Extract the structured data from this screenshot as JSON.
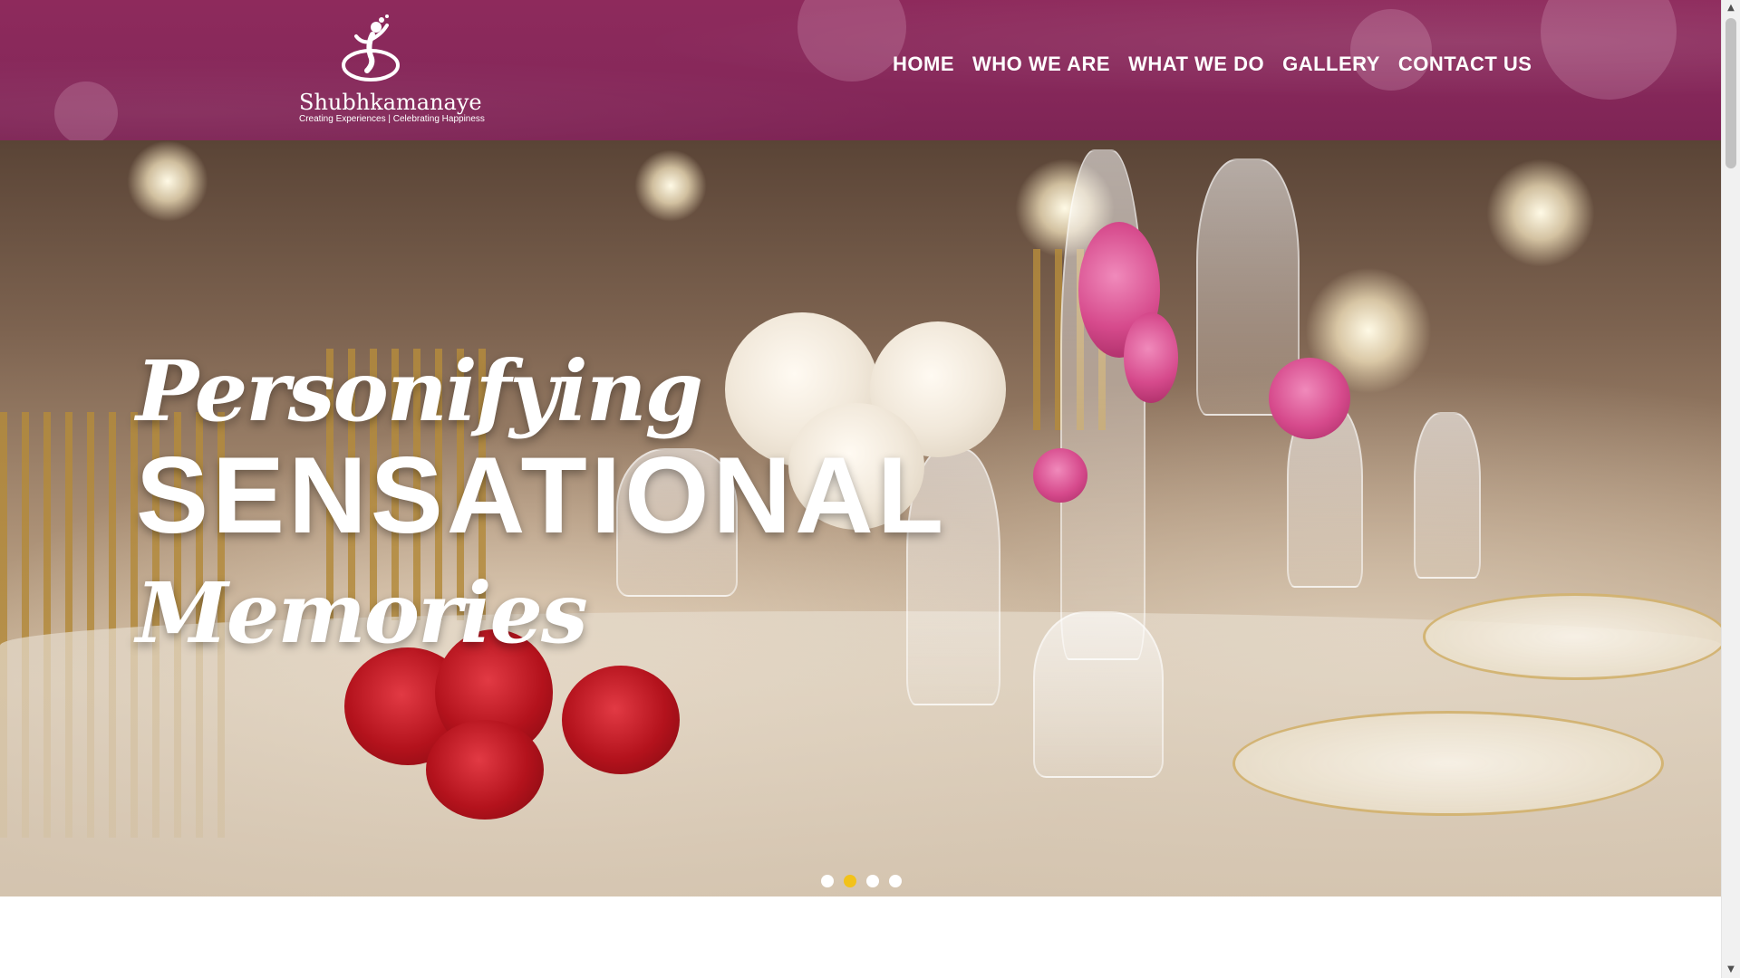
{
  "logo": {
    "name": "Shubhkamanaye",
    "tagline": "Creating Experiences | Celebrating Happiness",
    "icon": "dancing-figure-logo"
  },
  "nav": {
    "items": [
      {
        "label": "HOME"
      },
      {
        "label": "WHO WE ARE"
      },
      {
        "label": "WHAT WE DO"
      },
      {
        "label": "GALLERY"
      },
      {
        "label": "CONTACT US"
      }
    ]
  },
  "hero": {
    "line1": "Personifying",
    "line2": "SENSATIONAL",
    "line3": "Memories",
    "slide_count": 4,
    "active_slide": 2
  },
  "colors": {
    "header_bg": "#86285a",
    "active_dot": "#f2c21a",
    "text": "#ffffff"
  }
}
